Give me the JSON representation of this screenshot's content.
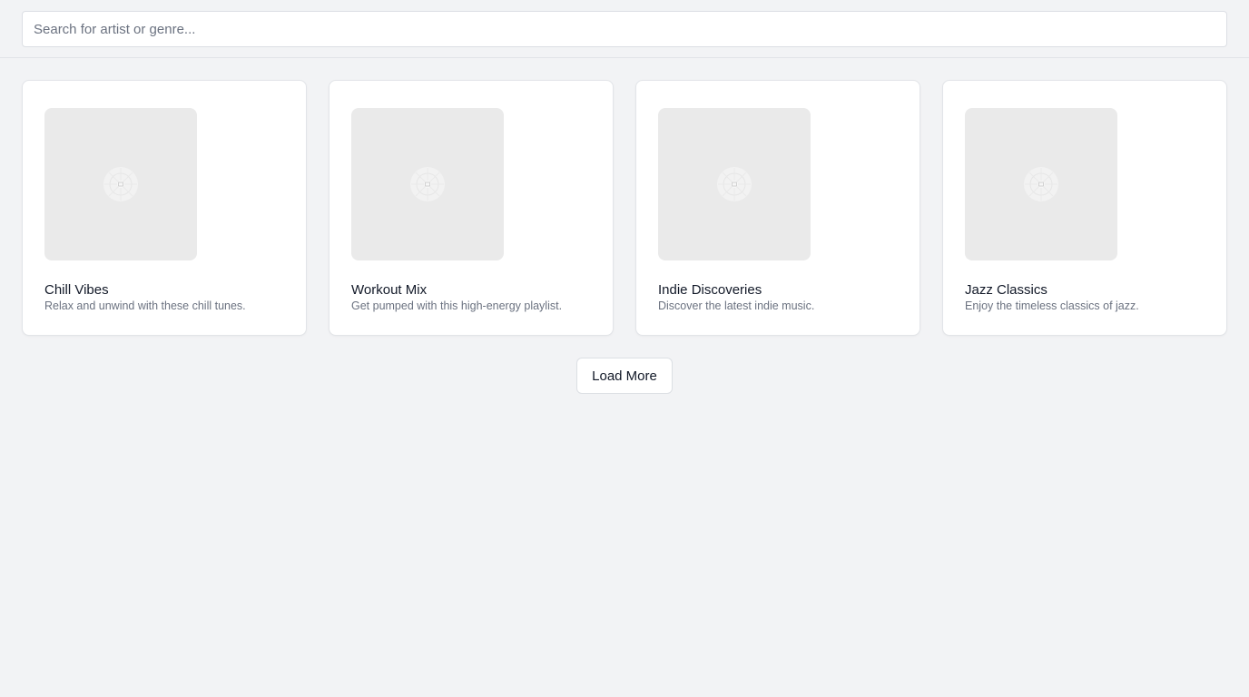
{
  "search": {
    "placeholder": "Search for artist or genre...",
    "value": ""
  },
  "playlists": [
    {
      "title": "Chill Vibes",
      "description": "Relax and unwind with these chill tunes.",
      "cover_icon": "image-placeholder-icon"
    },
    {
      "title": "Workout Mix",
      "description": "Get pumped with this high-energy playlist.",
      "cover_icon": "image-placeholder-icon"
    },
    {
      "title": "Indie Discoveries",
      "description": "Discover the latest indie music.",
      "cover_icon": "image-placeholder-icon"
    },
    {
      "title": "Jazz Classics",
      "description": "Enjoy the timeless classics of jazz.",
      "cover_icon": "image-placeholder-icon"
    }
  ],
  "load_more": {
    "label": "Load More"
  },
  "colors": {
    "background": "#f2f3f5",
    "card": "#ffffff",
    "cover_placeholder": "#eaeaea",
    "text_primary": "#111827",
    "text_secondary": "#6b7280"
  }
}
